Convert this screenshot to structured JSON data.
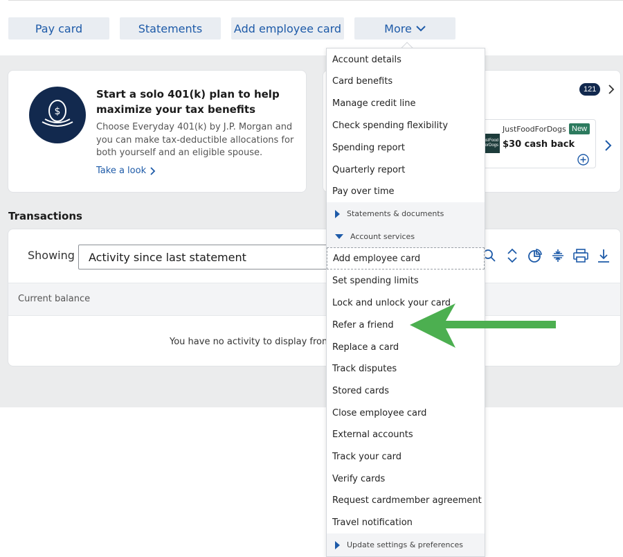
{
  "actions": {
    "pay_card": "Pay card",
    "statements": "Statements",
    "add_employee_card": "Add employee card",
    "more": "More"
  },
  "promo": {
    "title": "Start a solo 401(k) plan to help maximize your tax benefits",
    "body": "Choose Everyday 401(k) by J.P. Morgan and you can make tax-deductible allocations for both yourself and an eligible spouse.",
    "link": "Take a look",
    "icon": "nest-egg-dollar-icon"
  },
  "offers": {
    "count": "121",
    "merchant": "JustFoodForDogs",
    "badge": "New",
    "cash": "$30 cash back",
    "logo_text": "ustFood orDogs"
  },
  "transactions": {
    "heading": "Transactions",
    "showing_label": "Showing",
    "showing_value": "Activity since last statement",
    "balance_label": "Current balance",
    "empty_message": "You have no activity to display from th"
  },
  "menu": {
    "items_top": [
      "Account details",
      "Card benefits",
      "Manage credit line",
      "Check spending flexibility",
      "Spending report",
      "Quarterly report",
      "Pay over time"
    ],
    "section_statements": "Statements & documents",
    "section_services": "Account services",
    "items_services": [
      "Add employee card",
      "Set spending limits",
      "Lock and unlock your card",
      "Refer a friend",
      "Replace a card",
      "Track disputes",
      "Stored cards",
      "Close employee card",
      "External accounts",
      "Track your card",
      "Verify cards",
      "Request cardmember agreement",
      "Travel notification"
    ],
    "section_settings": "Update settings & preferences"
  },
  "colors": {
    "brand_navy": "#12294e",
    "link_blue": "#1d5aa8",
    "arrow_green": "#4caf50"
  }
}
